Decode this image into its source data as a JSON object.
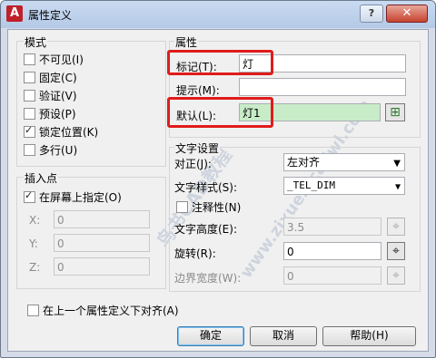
{
  "window": {
    "title": "属性定义",
    "app_icon": "A",
    "help_button": "?",
    "close_button": "✕"
  },
  "mode": {
    "group_label": "模式",
    "options": [
      {
        "label": "不可见(I)",
        "checked": false
      },
      {
        "label": "固定(C)",
        "checked": false
      },
      {
        "label": "验证(V)",
        "checked": false
      },
      {
        "label": "预设(P)",
        "checked": false
      },
      {
        "label": "锁定位置(K)",
        "checked": true
      },
      {
        "label": "多行(U)",
        "checked": false
      }
    ]
  },
  "attribute": {
    "group_label": "属性",
    "tag_label": "标记(T):",
    "tag_value": "灯",
    "prompt_label": "提示(M):",
    "prompt_value": "",
    "default_label": "默认(L):",
    "default_value": "灯1"
  },
  "insertion_point": {
    "group_label": "插入点",
    "specify_on_screen": {
      "label": "在屏幕上指定(O)",
      "checked": true
    },
    "x_label": "X:",
    "x_value": "0",
    "y_label": "Y:",
    "y_value": "0",
    "z_label": "Z:",
    "z_value": "0"
  },
  "text_settings": {
    "group_label": "文字设置",
    "justification_label": "对正(J):",
    "justification_value": "左对齐",
    "text_style_label": "文字样式(S):",
    "text_style_value": "_TEL_DIM",
    "annotative": {
      "label": "注释性(N)",
      "checked": false
    },
    "text_height_label": "文字高度(E):",
    "text_height_value": "3.5",
    "rotation_label": "旋转(R):",
    "rotation_value": "0",
    "boundary_width_label": "边界宽度(W):",
    "boundary_width_value": "0"
  },
  "align_below": {
    "label": "在上一个属性定义下对齐(A)",
    "checked": false
  },
  "buttons": {
    "ok": "确定",
    "cancel": "取消",
    "help": "帮助(H)"
  },
  "watermark": {
    "text1": "鸟书CAD教程",
    "text2": "www.zixue2.cadwl.com"
  }
}
